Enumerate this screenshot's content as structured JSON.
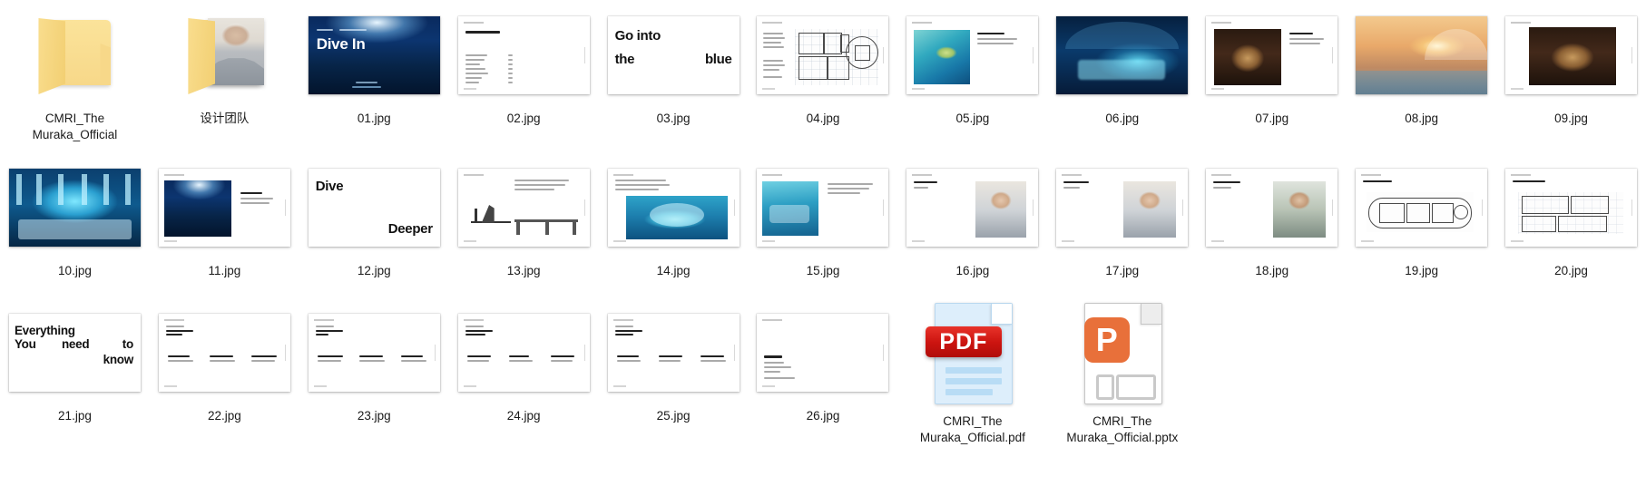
{
  "window": {
    "view": "icon-grid",
    "background_color": "#ffffff",
    "columns": 11,
    "rows": 3,
    "total_items": 30
  },
  "items": [
    {
      "name": "CMRI_The Muraka_Official",
      "label_line1": "CMRI_The",
      "label_line2": "Muraka_Official",
      "type": "folder",
      "icon": "folder-icon",
      "has_preview": false
    },
    {
      "name": "设计团队",
      "label_line1": "设计团队",
      "label_line2": "",
      "type": "folder",
      "icon": "folder-icon",
      "has_preview": true,
      "preview": "portrait-photo"
    },
    {
      "name": "01.jpg",
      "label_line1": "01.jpg",
      "label_line2": "",
      "type": "image",
      "icon": "slide-thumbnail",
      "slide_title": "Dive In",
      "slide_kind": "cover-photo"
    },
    {
      "name": "02.jpg",
      "label_line1": "02.jpg",
      "label_line2": "",
      "type": "image",
      "icon": "slide-thumbnail",
      "slide_title": "Table of Contents",
      "slide_kind": "toc"
    },
    {
      "name": "03.jpg",
      "label_line1": "03.jpg",
      "label_line2": "",
      "type": "image",
      "icon": "slide-thumbnail",
      "slide_title": "Go into the blue",
      "slide_kind": "big-type"
    },
    {
      "name": "04.jpg",
      "label_line1": "04.jpg",
      "label_line2": "",
      "type": "image",
      "icon": "slide-thumbnail",
      "slide_title": "",
      "slide_kind": "floor-plan"
    },
    {
      "name": "05.jpg",
      "label_line1": "05.jpg",
      "label_line2": "",
      "type": "image",
      "icon": "slide-thumbnail",
      "slide_title": "",
      "slide_kind": "photo-lagoon"
    },
    {
      "name": "06.jpg",
      "label_line1": "06.jpg",
      "label_line2": "",
      "type": "image",
      "icon": "slide-thumbnail",
      "slide_title": "",
      "slide_kind": "photo-bedroom-full"
    },
    {
      "name": "07.jpg",
      "label_line1": "07.jpg",
      "label_line2": "",
      "type": "image",
      "icon": "slide-thumbnail",
      "slide_title": "",
      "slide_kind": "photo-interior"
    },
    {
      "name": "08.jpg",
      "label_line1": "08.jpg",
      "label_line2": "",
      "type": "image",
      "icon": "slide-thumbnail",
      "slide_title": "",
      "slide_kind": "photo-sunset-full"
    },
    {
      "name": "09.jpg",
      "label_line1": "09.jpg",
      "label_line2": "",
      "type": "image",
      "icon": "slide-thumbnail",
      "slide_title": "",
      "slide_kind": "photo-interior"
    },
    {
      "name": "10.jpg",
      "label_line1": "10.jpg",
      "label_line2": "",
      "type": "image",
      "icon": "slide-thumbnail",
      "slide_title": "",
      "slide_kind": "photo-studio-full"
    },
    {
      "name": "11.jpg",
      "label_line1": "11.jpg",
      "label_line2": "",
      "type": "image",
      "icon": "slide-thumbnail",
      "slide_title": "",
      "slide_kind": "photo-underwater"
    },
    {
      "name": "12.jpg",
      "label_line1": "12.jpg",
      "label_line2": "",
      "type": "image",
      "icon": "slide-thumbnail",
      "slide_title": "Dive Deeper",
      "slide_kind": "big-type"
    },
    {
      "name": "13.jpg",
      "label_line1": "13.jpg",
      "label_line2": "",
      "type": "image",
      "icon": "slide-thumbnail",
      "slide_title": "Devoid of clutter, a seamless design that fully immerses the guest in the surrounding Indian Ocean.",
      "slide_kind": "drawing-text"
    },
    {
      "name": "14.jpg",
      "label_line1": "14.jpg",
      "label_line2": "",
      "type": "image",
      "icon": "slide-thumbnail",
      "slide_title": "Encased beneath a seabed acrylic dome, the residence presents a 180 degree panoramic view of the ocean world surrounding in coral garden and all.",
      "slide_kind": "photo-pool-text"
    },
    {
      "name": "15.jpg",
      "label_line1": "15.jpg",
      "label_line2": "",
      "type": "image",
      "icon": "slide-thumbnail",
      "slide_title": "This feat of aquatics technology is matched only by Muraka first entrance diving experience.",
      "slide_kind": "photo-aqua-text"
    },
    {
      "name": "16.jpg",
      "label_line1": "16.jpg",
      "label_line2": "",
      "type": "image",
      "icon": "slide-thumbnail",
      "slide_title": "Ahmed Saleem, Designer",
      "slide_kind": "person-portrait"
    },
    {
      "name": "17.jpg",
      "label_line1": "17.jpg",
      "label_line2": "",
      "type": "image",
      "icon": "slide-thumbnail",
      "slide_title": "Mike Murphy, Engineer",
      "slide_kind": "person-portrait"
    },
    {
      "name": "18.jpg",
      "label_line1": "18.jpg",
      "label_line2": "",
      "type": "image",
      "icon": "slide-thumbnail",
      "slide_title": "Yuji Yamazaki, Interior Designer",
      "slide_kind": "person-portrait-green"
    },
    {
      "name": "19.jpg",
      "label_line1": "19.jpg",
      "label_line2": "",
      "type": "image",
      "icon": "slide-thumbnail",
      "slide_title": "The Undersea Level",
      "slide_kind": "floor-plan-dark"
    },
    {
      "name": "20.jpg",
      "label_line1": "20.jpg",
      "label_line2": "",
      "type": "image",
      "icon": "slide-thumbnail",
      "slide_title": "The Above Ocean Level",
      "slide_kind": "floor-plan-light"
    },
    {
      "name": "21.jpg",
      "label_line1": "21.jpg",
      "label_line2": "",
      "type": "image",
      "icon": "slide-thumbnail",
      "slide_title": "Everything You need to know",
      "slide_kind": "big-type"
    },
    {
      "name": "22.jpg",
      "label_line1": "22.jpg",
      "label_line2": "",
      "type": "image",
      "icon": "slide-thumbnail",
      "slide_title": "Included Services Booking",
      "slide_kind": "three-column"
    },
    {
      "name": "23.jpg",
      "label_line1": "23.jpg",
      "label_line2": "",
      "type": "image",
      "icon": "slide-thumbnail",
      "slide_title": "Included Services Arrival",
      "slide_kind": "three-column"
    },
    {
      "name": "24.jpg",
      "label_line1": "24.jpg",
      "label_line2": "",
      "type": "image",
      "icon": "slide-thumbnail",
      "slide_title": "Included Services Experience",
      "slide_kind": "three-column"
    },
    {
      "name": "25.jpg",
      "label_line1": "25.jpg",
      "label_line2": "",
      "type": "image",
      "icon": "slide-thumbnail",
      "slide_title": "Included Services Departure",
      "slide_kind": "three-column"
    },
    {
      "name": "26.jpg",
      "label_line1": "26.jpg",
      "label_line2": "",
      "type": "image",
      "icon": "slide-thumbnail",
      "slide_title": "Contact",
      "slide_kind": "contact"
    },
    {
      "name": "CMRI_The Muraka_Official.pdf",
      "label_line1": "CMRI_The",
      "label_line2": "Muraka_Official.pdf",
      "type": "pdf",
      "icon": "pdf-file-icon",
      "badge_text": "PDF",
      "badge_color": "#cc1410"
    },
    {
      "name": "CMRI_The Muraka_Official.pptx",
      "label_line1": "CMRI_The",
      "label_line2": "Muraka_Official.pptx",
      "type": "pptx",
      "icon": "powerpoint-file-icon",
      "badge_text": "P",
      "badge_color": "#e8703a"
    }
  ],
  "slide_text": {
    "s01_title": "Dive In",
    "s02_title": "Table of Contents",
    "s02_entries": [
      "Introduction",
      "Immersion",
      "Design",
      "The Team",
      "Floorplans",
      "Booking",
      "Arrival",
      "Realization",
      "Departure",
      "Contact"
    ],
    "s02_pages": [
      "3",
      "6",
      "12",
      "18",
      "22",
      "25",
      "28",
      "30",
      "32",
      "35"
    ],
    "s03_line1": "Go into",
    "s03_line2": "the",
    "s03_line3": "blue",
    "s12_line1": "Dive",
    "s12_line2": "Deeper",
    "s21_line1": "Everything",
    "s21_line2": "You",
    "s21_line3": "need",
    "s21_line4": "to",
    "s21_line5": "know",
    "s26_title": "Contact"
  }
}
